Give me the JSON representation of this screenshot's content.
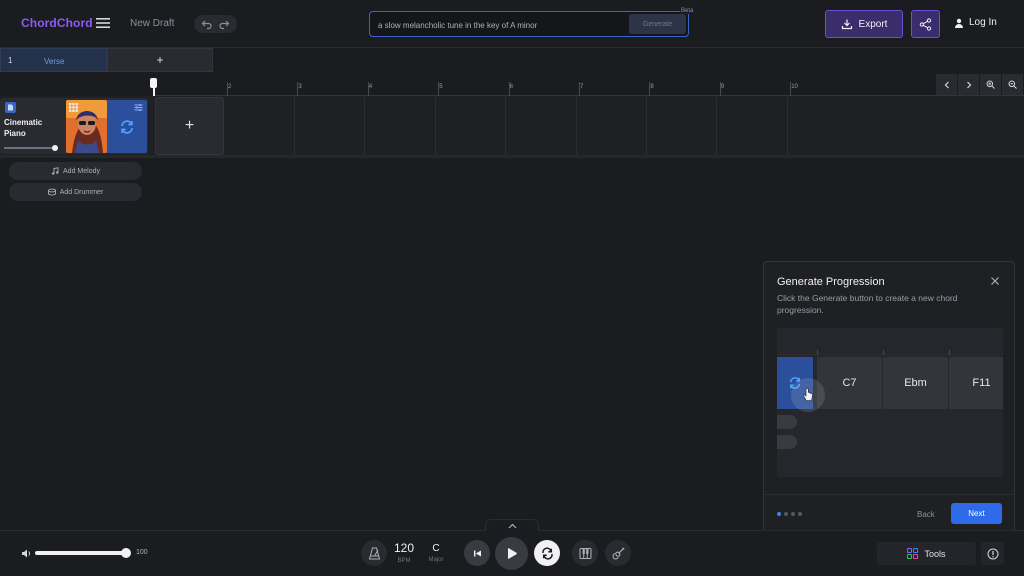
{
  "app": {
    "logo": "ChordChord",
    "draft_title": "New Draft"
  },
  "prompt": {
    "value": "a slow melancholic tune in the key of A minor",
    "generate_label": "Generate",
    "beta_label": "Beta"
  },
  "header": {
    "export_label": "Export",
    "login_label": "Log In"
  },
  "sections": {
    "items": [
      {
        "number": "1",
        "label": "Verse"
      }
    ],
    "add_label": "+"
  },
  "ruler": {
    "marks": [
      "2",
      "3",
      "4",
      "5",
      "6",
      "7",
      "8",
      "9",
      "10"
    ]
  },
  "track": {
    "instrument_name": "Cinematic Piano",
    "add_chord_label": "+",
    "add_melody_label": "Add Melody",
    "add_drummer_label": "Add Drummer",
    "volume_level": 0.95
  },
  "tutorial": {
    "title": "Generate Progression",
    "text": "Click the Generate button to create a new chord progression.",
    "demo_chords": [
      "C7",
      "Ebm",
      "F11"
    ],
    "step_count": 4,
    "active_step": 1,
    "back_label": "Back",
    "next_label": "Next"
  },
  "transport": {
    "volume_value": "100",
    "bpm_value": "120",
    "bpm_label": "BPM",
    "key_value": "C",
    "key_mode": "Major",
    "tools_label": "Tools"
  },
  "colors": {
    "accent": "#8b5cf6",
    "primary": "#2f6ae8",
    "background": "#1b1c20"
  }
}
